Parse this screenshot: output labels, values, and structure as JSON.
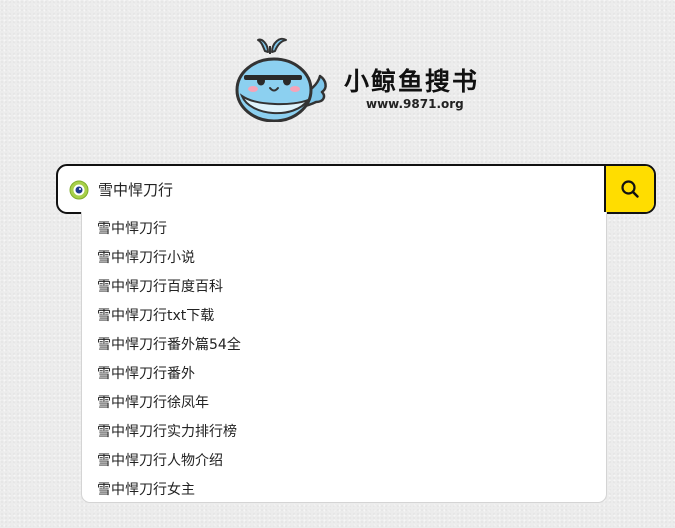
{
  "brand": {
    "name": "小鲸鱼搜书",
    "domain": "www.9871.org",
    "logo_icon": "whale-icon"
  },
  "search": {
    "value": "雪中悍刀行",
    "placeholder": "",
    "left_icon": "eye-icon",
    "button_icon": "search-icon",
    "button_color": "#ffdd00"
  },
  "suggestions": [
    "雪中悍刀行",
    "雪中悍刀行小说",
    "雪中悍刀行百度百科",
    "雪中悍刀行txt下载",
    "雪中悍刀行番外篇54全",
    "雪中悍刀行番外",
    "雪中悍刀行徐凤年",
    "雪中悍刀行实力排行榜",
    "雪中悍刀行人物介绍",
    "雪中悍刀行女主"
  ]
}
